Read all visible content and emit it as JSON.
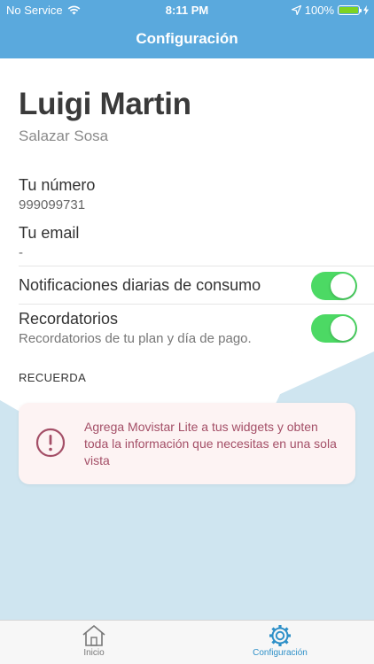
{
  "status_bar": {
    "carrier": "No Service",
    "time": "8:11 PM",
    "battery": "100%",
    "battery_level": 1.0
  },
  "nav": {
    "title": "Configuración"
  },
  "profile": {
    "name": "Luigi Martin",
    "surname": "Salazar Sosa"
  },
  "fields": {
    "phone_label": "Tu número",
    "phone_value": "999099731",
    "email_label": "Tu email",
    "email_value": "-"
  },
  "settings": {
    "daily_notifications": {
      "title": "Notificaciones diarias de consumo",
      "enabled": true
    },
    "reminders": {
      "title": "Recordatorios",
      "subtitle": "Recordatorios de tu plan y día de pago.",
      "enabled": true
    }
  },
  "reminder_section": {
    "header": "RECUERDA",
    "card_text": "Agrega Movistar Lite a tus widgets y obten toda la información que necesitas en una sola vista"
  },
  "tab_bar": {
    "items": [
      {
        "label": "Inicio",
        "icon": "home-icon",
        "active": false
      },
      {
        "label": "Configuración",
        "icon": "gear-icon",
        "active": true
      }
    ]
  },
  "colors": {
    "brand_blue": "#5aa9dd",
    "toggle_on": "#4cd964",
    "alert_text": "#a44f67",
    "active_tab": "#2e90c8"
  }
}
